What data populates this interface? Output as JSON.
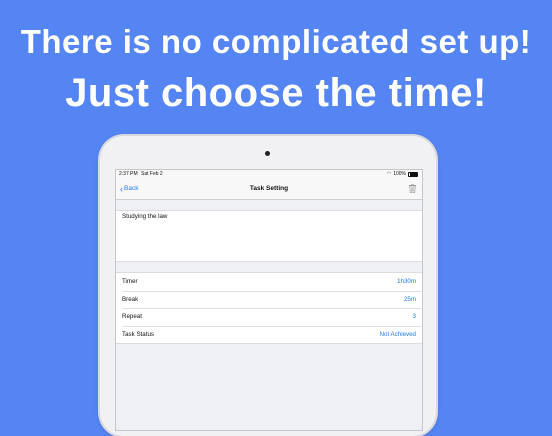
{
  "headline": {
    "line1": "There is no complicated set up!",
    "line2": "Just choose the time!"
  },
  "status_bar": {
    "time": "2:37 PM",
    "date": "Sat Feb 2",
    "battery": "100%"
  },
  "nav": {
    "back_label": "Back",
    "title": "Task Setting"
  },
  "note": {
    "text": "Studying the law"
  },
  "settings": [
    {
      "label": "Timer",
      "value": "1h30m"
    },
    {
      "label": "Break",
      "value": "25m"
    },
    {
      "label": "Repeat",
      "value": "3"
    },
    {
      "label": "Task Status",
      "value": "Not Achieved"
    }
  ],
  "colors": {
    "background": "#5585f2",
    "accent": "#1f7aed"
  }
}
